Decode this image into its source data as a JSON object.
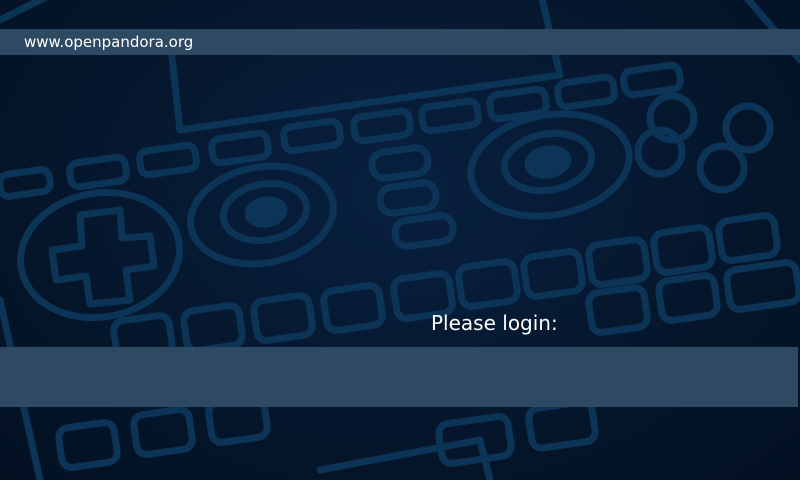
{
  "header": {
    "url_text": "www.openpandora.org"
  },
  "login": {
    "prompt": "Please login:",
    "value": ""
  },
  "colors": {
    "background": "#05172d",
    "bar": "#2e4a62",
    "art_stroke": "#0c3457",
    "text": "#ffffff"
  },
  "icons": {
    "background_art": "pandora-device-outline-art"
  }
}
